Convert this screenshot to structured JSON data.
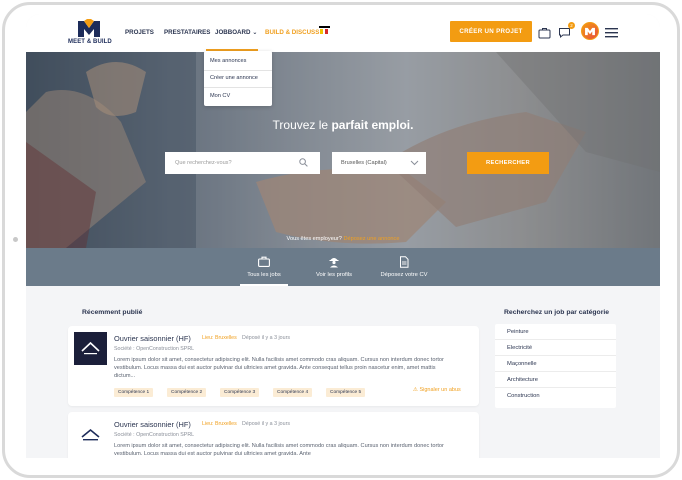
{
  "header": {
    "logo_text": "MEET & BUILD",
    "nav": {
      "projets": "PROJETS",
      "prestataires": "PRESTATAIRES",
      "jobboard": "JOBBOARD",
      "build_discuss": "BUILD & DISCUSS"
    },
    "create_project_button": "CRÉER UN PROJET",
    "notification_count": "2",
    "colors": {
      "accent": "#f39c12",
      "navy": "#1d2c5a"
    }
  },
  "jobboard_menu": {
    "items": [
      "Mes annonces",
      "Créer une annonce",
      "Mon CV"
    ]
  },
  "hero": {
    "title_prefix": "Trouvez le",
    "title_bold": "parfait emploi.",
    "search_placeholder": "Que recherchez-vous?",
    "location_value": "Bruxelles (Capital)",
    "search_button": "RECHERCHER",
    "employer_text": "Vous êtes employeur?",
    "employer_link": "Déposez une annonce"
  },
  "tabs": [
    {
      "label": "Tous les jobs",
      "icon": "briefcase-icon",
      "active": true
    },
    {
      "label": "Voir les profils",
      "icon": "worker-icon",
      "active": false
    },
    {
      "label": "Déposez votre CV",
      "icon": "document-icon",
      "active": false
    }
  ],
  "recent": {
    "title": "Récemment publié",
    "jobs": [
      {
        "title": "Ouvrier saisonnier (HF)",
        "location": "Lieu: Bruxelles",
        "date": "Déposé il y a 3 jours",
        "company": "Société : OpenConstruction SPRL",
        "description": "Lorem ipsum dolor sit amet, consectetur adipiscing elit. Nulla facilisis amet commodo cras aliquam. Cursus non interdum donec tortor vestibulum. Locus massa dui est auctor pulvinar dui ultricies amet gravida. Ante consequat tellus proin nascetur enim, amet mattis dictum...",
        "skills": [
          "Compétence 1",
          "Compétence 2",
          "Compétence 3",
          "Compétence 4",
          "Compétence 5"
        ],
        "report": "Signaler un abus"
      },
      {
        "title": "Ouvrier saisonnier (HF)",
        "location": "Lieu: Bruxelles",
        "date": "Déposé il y a 3 jours",
        "company": "Société : OpenConstruction SPRL",
        "description": "Lorem ipsum dolor sit amet, consectetur adipiscing elit. Nulla facilisis amet commodo cras aliquam. Cursus non interdum donec tortor vestibulum. Locus massa dui est auctor pulvinar dui ultricies amet gravida. Ante"
      }
    ]
  },
  "categories": {
    "title": "Recherchez un job par catégorie",
    "items": [
      "Peinture",
      "Electricité",
      "Maçonnelle",
      "Architecture",
      "Construction"
    ]
  }
}
